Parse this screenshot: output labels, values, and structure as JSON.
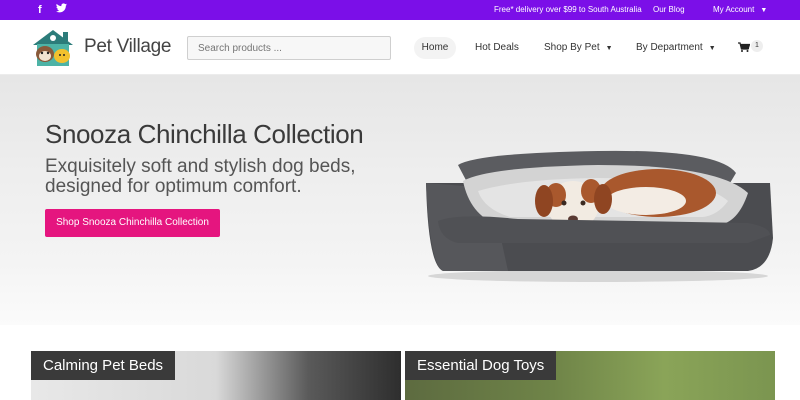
{
  "topbar": {
    "social": [
      {
        "icon": "facebook-icon",
        "glyph": "f"
      },
      {
        "icon": "twitter-icon",
        "glyph": "🐦"
      }
    ],
    "promo": "Free* delivery over $99 to South Australia",
    "blog": "Our Blog",
    "account": "My Account",
    "bg_color": "#7b0fe8"
  },
  "header": {
    "brand": "Pet Village",
    "search_placeholder": "Search products ...",
    "nav": {
      "home": "Home",
      "hot_deals": "Hot Deals",
      "shop_by_pet": "Shop By Pet",
      "by_department": "By Department"
    },
    "cart_count": "1"
  },
  "hero": {
    "title": "Snooza Chinchilla Collection",
    "subtitle": "Exquisitely soft and stylish dog beds, designed for optimum comfort.",
    "button": "Shop Snooza Chinchilla Collection",
    "button_color": "#e5157f"
  },
  "tiles": [
    {
      "label": "Calming Pet Beds"
    },
    {
      "label": "Essential Dog Toys"
    }
  ]
}
